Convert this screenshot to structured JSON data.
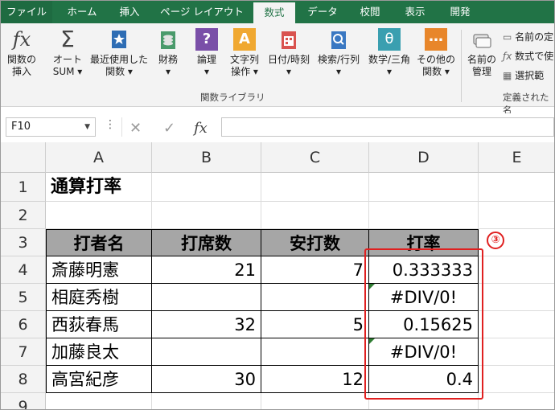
{
  "tabs": [
    "ファイル",
    "ホーム",
    "挿入",
    "ページ レイアウト",
    "数式",
    "データ",
    "校閲",
    "表示",
    "開発"
  ],
  "active_tab": "数式",
  "ribbon": {
    "insert_function": {
      "icon": "fx",
      "l1": "関数の",
      "l2": "挿入"
    },
    "autosum": {
      "icon": "Σ",
      "l1": "オート",
      "l2": "SUM ▾"
    },
    "recent": {
      "l1": "最近使用した",
      "l2": "関数 ▾"
    },
    "financial": {
      "l1": "財務",
      "l2": "▾"
    },
    "logical": {
      "icon": "?",
      "l1": "論理",
      "l2": "▾"
    },
    "text": {
      "icon": "A",
      "l1": "文字列",
      "l2": "操作 ▾"
    },
    "datetime": {
      "l1": "日付/時刻",
      "l2": "▾"
    },
    "lookup": {
      "l1": "検索/行列",
      "l2": "▾"
    },
    "math": {
      "icon": "θ",
      "l1": "数学/三角",
      "l2": "▾"
    },
    "more": {
      "icon": "…",
      "l1": "その他の",
      "l2": "関数 ▾"
    },
    "group_label": "関数ライブラリ",
    "name_manager": {
      "l1": "名前の",
      "l2": "管理"
    },
    "define_name": "名前の定",
    "use_in_formula": "数式で使",
    "create_from_selection": "選択範",
    "defined_names_label": "定義された名"
  },
  "formula_bar": {
    "name_box": "F10",
    "dots": "⋮",
    "cancel": "✕",
    "enter": "✓",
    "fx": "fx",
    "value": ""
  },
  "columns": [
    "A",
    "B",
    "C",
    "D",
    "E"
  ],
  "rows": [
    "1",
    "2",
    "3",
    "4",
    "5",
    "6",
    "7",
    "8",
    "9"
  ],
  "sheet": {
    "title": "通算打率",
    "headers": [
      "打者名",
      "打席数",
      "安打数",
      "打率"
    ],
    "data": [
      {
        "name": "斎藤明憲",
        "at_bats": "21",
        "hits": "7",
        "avg": "0.333333"
      },
      {
        "name": "相庭秀樹",
        "at_bats": "",
        "hits": "",
        "avg": "#DIV/0!"
      },
      {
        "name": "西荻春馬",
        "at_bats": "32",
        "hits": "5",
        "avg": "0.15625"
      },
      {
        "name": "加藤良太",
        "at_bats": "",
        "hits": "",
        "avg": "#DIV/0!"
      },
      {
        "name": "高宮紀彦",
        "at_bats": "30",
        "hits": "12",
        "avg": "0.4"
      }
    ]
  },
  "annotation": "③",
  "colors": {
    "excel_green": "#217346",
    "header_fill": "#a6a6a6",
    "annotation_red": "#e02020",
    "error_indicator": "#2f7d32"
  }
}
